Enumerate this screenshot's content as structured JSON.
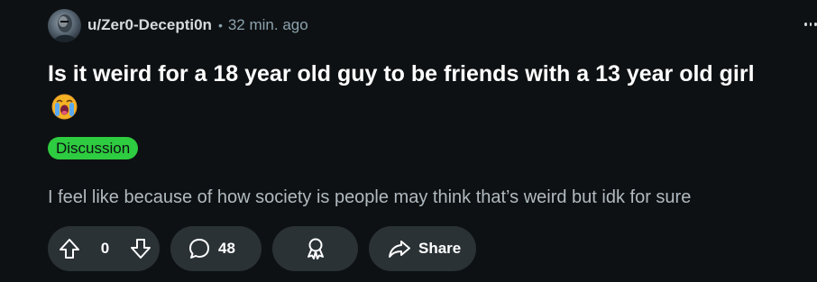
{
  "post": {
    "author": "u/Zer0-Decepti0n",
    "separator": "•",
    "time_ago": "32 min. ago",
    "title": "Is it weird for a 18 year old guy to be friends with a 13 year old girl",
    "title_emoji": "crying-face-emoji",
    "flair": "Discussion",
    "flair_color": "#2ecc40",
    "body": "I feel like because of how society is people may think that’s weird but idk for sure"
  },
  "actions": {
    "vote_count": "0",
    "comment_count": "48",
    "share_label": "Share"
  },
  "icons": {
    "upvote": "arrow-up-icon",
    "downvote": "arrow-down-icon",
    "comment": "speech-bubble-icon",
    "award": "award-ribbon-icon",
    "share": "share-arrow-icon",
    "menu": "more-dots-icon"
  },
  "colors": {
    "background": "#0e1113",
    "pill": "#2a3236",
    "muted_text": "#8ba2ad"
  }
}
